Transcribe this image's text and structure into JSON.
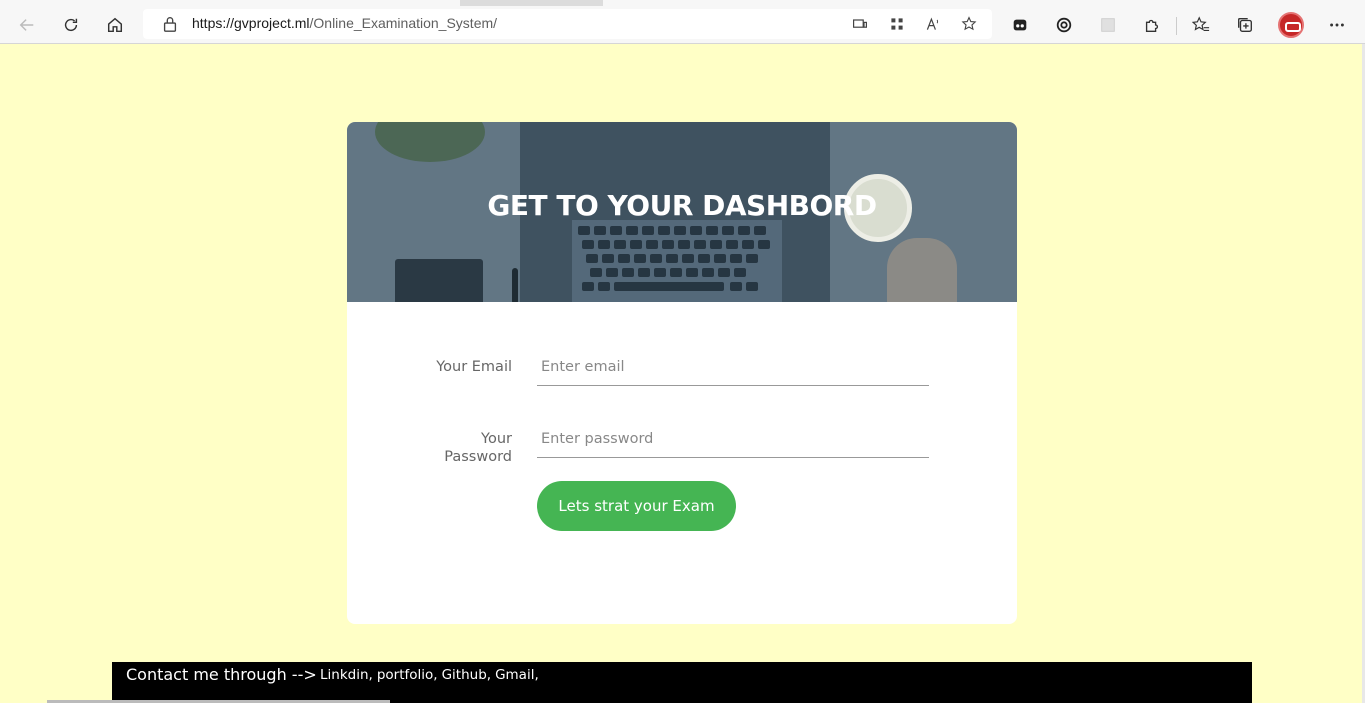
{
  "browser": {
    "url_host": "https://gvproject.ml",
    "url_path": "/Online_Examination_System/",
    "icons": {
      "back": "back-arrow-icon",
      "refresh": "refresh-icon",
      "home": "home-icon",
      "lock": "lock-icon",
      "device": "device-icon",
      "apps": "apps-icon",
      "read_aloud": "read-aloud-icon",
      "favorite_add": "favorite-add-icon",
      "extension1": "extension-icon",
      "extension2": "copilot-icon",
      "extension3": "grid-extension-icon",
      "puzzle": "puzzle-icon",
      "favorites": "favorites-icon",
      "collections": "collections-icon",
      "profile": "profile-avatar",
      "more": "more-icon"
    }
  },
  "card": {
    "title": "GET TO YOUR DASHBORD",
    "email_label": "Your Email",
    "email_placeholder": "Enter email",
    "email_value": "",
    "password_label_line1": "Your",
    "password_label_line2": "Password",
    "password_placeholder": "Enter password",
    "password_value": "",
    "submit_label": "Lets strat your Exam"
  },
  "footer": {
    "lead": "Contact me through -->",
    "links": [
      "Linkdin,",
      "portfolio,",
      "Github,",
      "Gmail,"
    ]
  },
  "colors": {
    "page_bg": "#ffffc6",
    "button": "#45b553",
    "banner_overlay": "#627684",
    "footer_bg": "#000000"
  }
}
